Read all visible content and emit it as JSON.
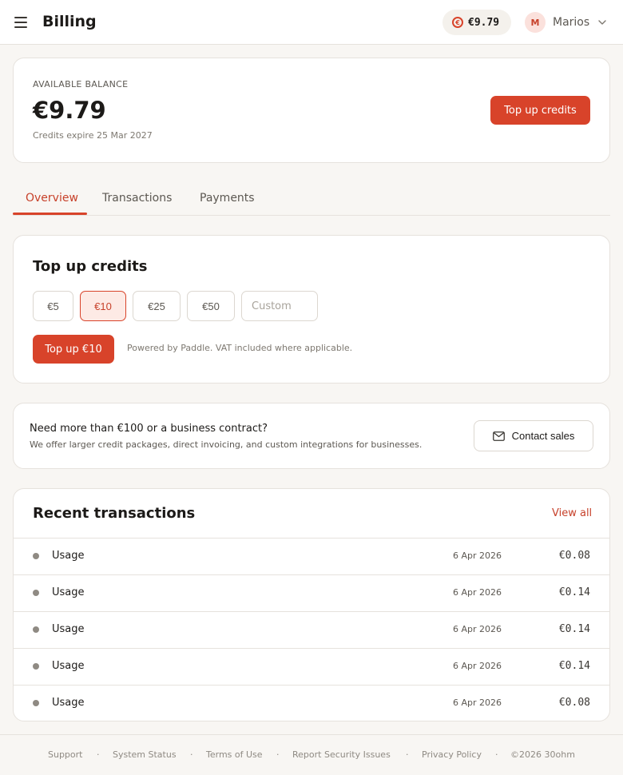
{
  "header": {
    "title": "Billing",
    "balance_chip": {
      "symbol": "€",
      "value": "€9.79"
    },
    "user": {
      "initial": "M",
      "name": "Marios"
    }
  },
  "balance_card": {
    "label": "AVAILABLE BALANCE",
    "amount": "€9.79",
    "expiry": "Credits expire 25 Mar 2027",
    "topup_button": "Top up credits"
  },
  "tabs": [
    {
      "label": "Overview",
      "active": true
    },
    {
      "label": "Transactions",
      "active": false
    },
    {
      "label": "Payments",
      "active": false
    }
  ],
  "topup": {
    "heading": "Top up credits",
    "options": [
      {
        "label": "€5",
        "selected": false
      },
      {
        "label": "€10",
        "selected": true
      },
      {
        "label": "€25",
        "selected": false
      },
      {
        "label": "€50",
        "selected": false
      }
    ],
    "custom_placeholder": "Custom",
    "submit_label": "Top up €10",
    "note": "Powered by Paddle. VAT included where applicable."
  },
  "sales": {
    "title": "Need more than €100 or a business contract?",
    "description": "We offer larger credit packages, direct invoicing, and custom integrations for businesses.",
    "button": "Contact sales"
  },
  "transactions": {
    "heading": "Recent transactions",
    "view_all": "View all",
    "rows": [
      {
        "type": "Usage",
        "date": "6 Apr 2026",
        "amount": "€0.08"
      },
      {
        "type": "Usage",
        "date": "6 Apr 2026",
        "amount": "€0.14"
      },
      {
        "type": "Usage",
        "date": "6 Apr 2026",
        "amount": "€0.14"
      },
      {
        "type": "Usage",
        "date": "6 Apr 2026",
        "amount": "€0.14"
      },
      {
        "type": "Usage",
        "date": "6 Apr 2026",
        "amount": "€0.08"
      }
    ]
  },
  "footer": {
    "links": [
      "Support",
      "System Status",
      "Terms of Use",
      "Report Security Issues",
      "Privacy Policy"
    ],
    "separator": "·",
    "copyright": "©2026 30ohm"
  },
  "colors": {
    "accent": "#d8432a",
    "accent_soft": "#fdeae5",
    "background": "#f8f6f3",
    "border": "#e6e2dd"
  }
}
